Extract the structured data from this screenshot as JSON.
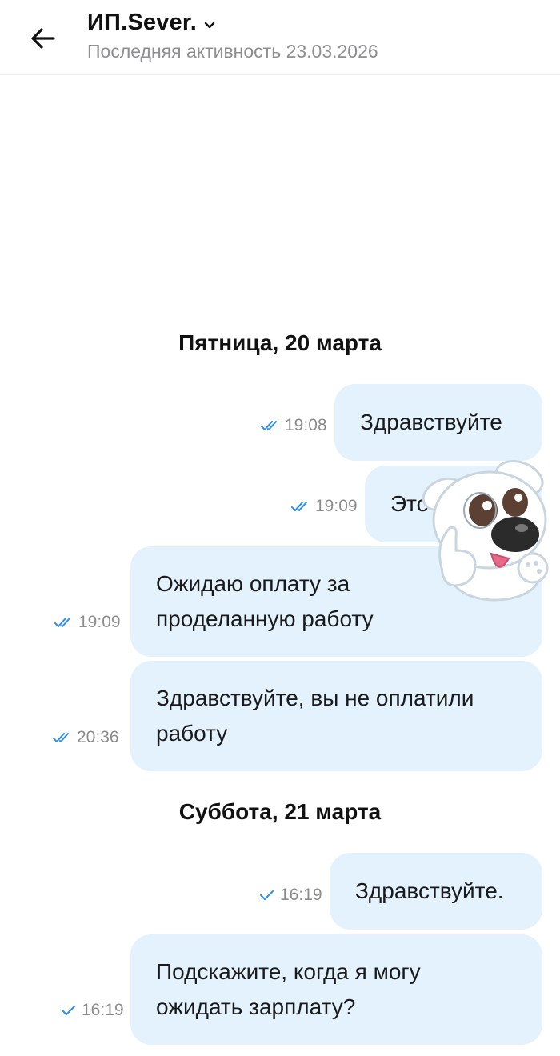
{
  "header": {
    "title": "ИП.Sever.",
    "subtitle": "Последняя активность 23.03.2026"
  },
  "days": [
    {
      "label": "Пятница, 20 марта",
      "messages": [
        {
          "text": "Здравствуйте",
          "time": "19:08",
          "status": "read"
        },
        {
          "text": "Это",
          "time": "19:09",
          "status": "read"
        },
        {
          "text": "Ожидаю оплату за\nпроделанную работу",
          "time": "19:09",
          "status": "read"
        },
        {
          "text": "Здравствуйте, вы не оплатили\nработу",
          "time": "20:36",
          "status": "read"
        }
      ]
    },
    {
      "label": "Суббота, 21 марта",
      "messages": [
        {
          "text": "Здравствуйте.",
          "time": "16:19",
          "status": "sent"
        },
        {
          "text": "Подскажите, когда я могу\nожидать зарплату?",
          "time": "16:19",
          "status": "sent"
        }
      ]
    }
  ],
  "colors": {
    "bubble": "#e3f2fd",
    "check": "#2e8ef0",
    "muted": "#8e8e93"
  },
  "icons": {
    "back": "arrow-left-icon",
    "chevron": "chevron-down-icon",
    "read": "double-check-icon",
    "sent": "single-check-icon",
    "sticker": "dog-thumbs-up-sticker"
  }
}
